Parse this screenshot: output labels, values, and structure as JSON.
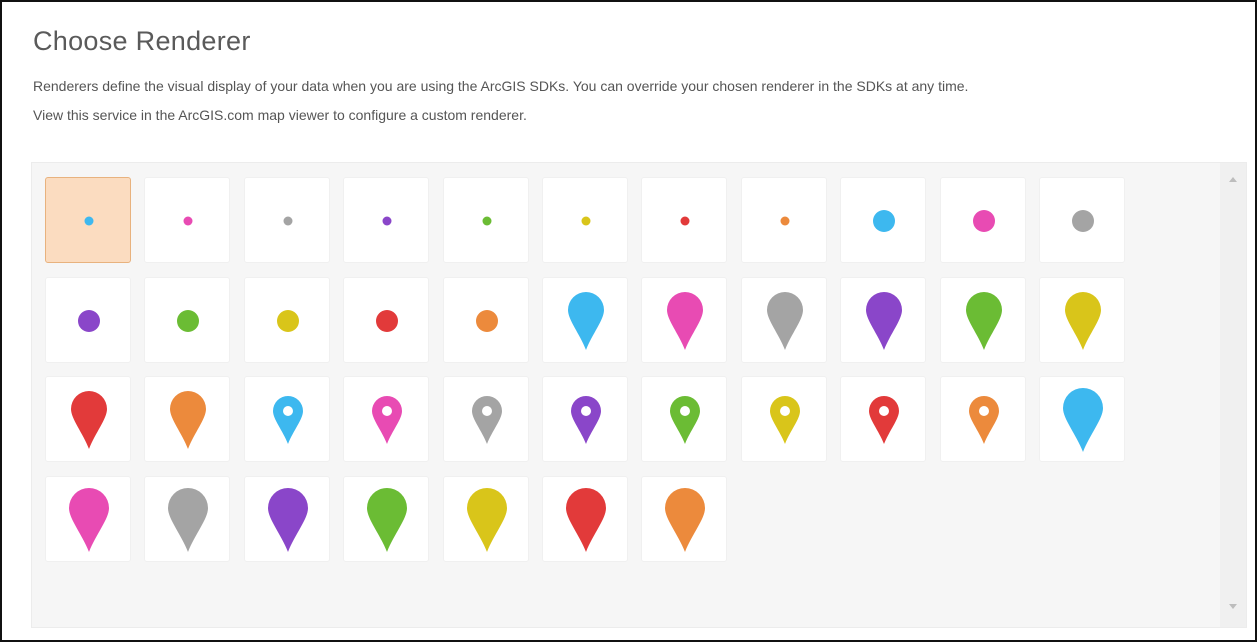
{
  "dialog": {
    "title": "Choose Renderer",
    "description_line1": "Renderers define the visual display of your data when you are using the ArcGIS SDKs. You can override your chosen renderer in the SDKs at any time.",
    "description_line2": "View this service in the ArcGIS.com map viewer to configure a custom renderer."
  },
  "palette": {
    "blue": "#3db8ef",
    "pink": "#e84bb3",
    "gray": "#a4a4a4",
    "purple": "#8a46c9",
    "green": "#6bbc34",
    "yellow": "#d9c51a",
    "red": "#e23a3a",
    "orange": "#ec8a3c",
    "selected_tile": "#fbdcc0"
  },
  "renderers": [
    {
      "style": "small-dot",
      "color": "blue",
      "selected": true
    },
    {
      "style": "small-dot",
      "color": "pink"
    },
    {
      "style": "small-dot",
      "color": "gray"
    },
    {
      "style": "small-dot",
      "color": "purple"
    },
    {
      "style": "small-dot",
      "color": "green"
    },
    {
      "style": "small-dot",
      "color": "yellow"
    },
    {
      "style": "small-dot",
      "color": "red"
    },
    {
      "style": "small-dot",
      "color": "orange"
    },
    {
      "style": "large-dot",
      "color": "blue"
    },
    {
      "style": "large-dot",
      "color": "pink"
    },
    {
      "style": "large-dot",
      "color": "gray"
    },
    {
      "style": "large-dot",
      "color": "purple"
    },
    {
      "style": "large-dot",
      "color": "green"
    },
    {
      "style": "large-dot",
      "color": "yellow"
    },
    {
      "style": "large-dot",
      "color": "red"
    },
    {
      "style": "large-dot",
      "color": "orange"
    },
    {
      "style": "pin",
      "color": "blue"
    },
    {
      "style": "pin",
      "color": "pink"
    },
    {
      "style": "pin",
      "color": "gray"
    },
    {
      "style": "pin",
      "color": "purple"
    },
    {
      "style": "pin",
      "color": "green"
    },
    {
      "style": "pin",
      "color": "yellow"
    },
    {
      "style": "pin",
      "color": "red"
    },
    {
      "style": "pin",
      "color": "orange"
    },
    {
      "style": "pin-hole",
      "color": "blue"
    },
    {
      "style": "pin-hole",
      "color": "pink"
    },
    {
      "style": "pin-hole",
      "color": "gray"
    },
    {
      "style": "pin-hole",
      "color": "purple"
    },
    {
      "style": "pin-hole",
      "color": "green"
    },
    {
      "style": "pin-hole",
      "color": "yellow"
    },
    {
      "style": "pin-hole",
      "color": "red"
    },
    {
      "style": "pin-hole",
      "color": "orange"
    },
    {
      "style": "large-pin",
      "color": "blue"
    },
    {
      "style": "large-pin",
      "color": "pink"
    },
    {
      "style": "large-pin",
      "color": "gray"
    },
    {
      "style": "large-pin",
      "color": "purple"
    },
    {
      "style": "large-pin",
      "color": "green"
    },
    {
      "style": "large-pin",
      "color": "yellow"
    },
    {
      "style": "large-pin",
      "color": "red"
    },
    {
      "style": "large-pin",
      "color": "orange"
    }
  ],
  "icons": {
    "scroll_up": "chevron-up-icon",
    "scroll_down": "chevron-down-icon"
  }
}
